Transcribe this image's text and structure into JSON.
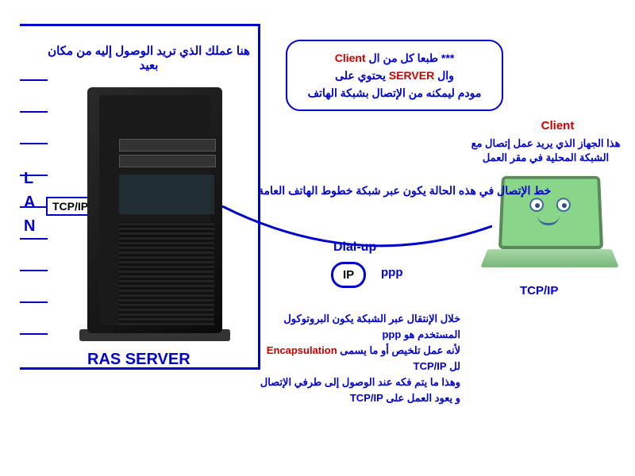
{
  "server": {
    "desc": "هنا عملك الذي تريد الوصول إليه من مكان بعيد",
    "protocol": "TCP/IP",
    "lan_label": "L\nA\nN",
    "ras": "RAS SERVER"
  },
  "note": {
    "line1_ar": "*** طبعا كل من ال",
    "line1_en": "Client",
    "line2_ar": "يحتوي على",
    "line2_en": "SERVER",
    "line2_prefix": "وال",
    "line3": "مودم ليمكنه من الإتصال بشبكة الهاتف"
  },
  "client": {
    "title": "Client",
    "desc": "هذا الجهاز الذي يريد عمل إتصال مع الشبكة المحلية في مقر العمل",
    "protocol": "TCP/IP"
  },
  "connection": {
    "line_desc": "خط الإتصال في هذه الحالة يكون عبر شبكة خطوط الهاتف العامة",
    "dialup": "Dial-up",
    "ip": "IP",
    "ppp": "ppp"
  },
  "explain": {
    "l1a": "خلال الإنتقال عبر الشبكة يكون البروتوكول المستخدم هو",
    "l1b": "ppp",
    "l2a": "لأنه عمل تلخيص أو ما يسمى",
    "l2b": "Encapsulation",
    "l2c": "لل",
    "l2d": "TCP/IP",
    "l3": "وهذا ما يتم فكه عند الوصول إلى طرفي الإتصال",
    "l4a": "و يعود العمل على",
    "l4b": "TCP/IP"
  }
}
